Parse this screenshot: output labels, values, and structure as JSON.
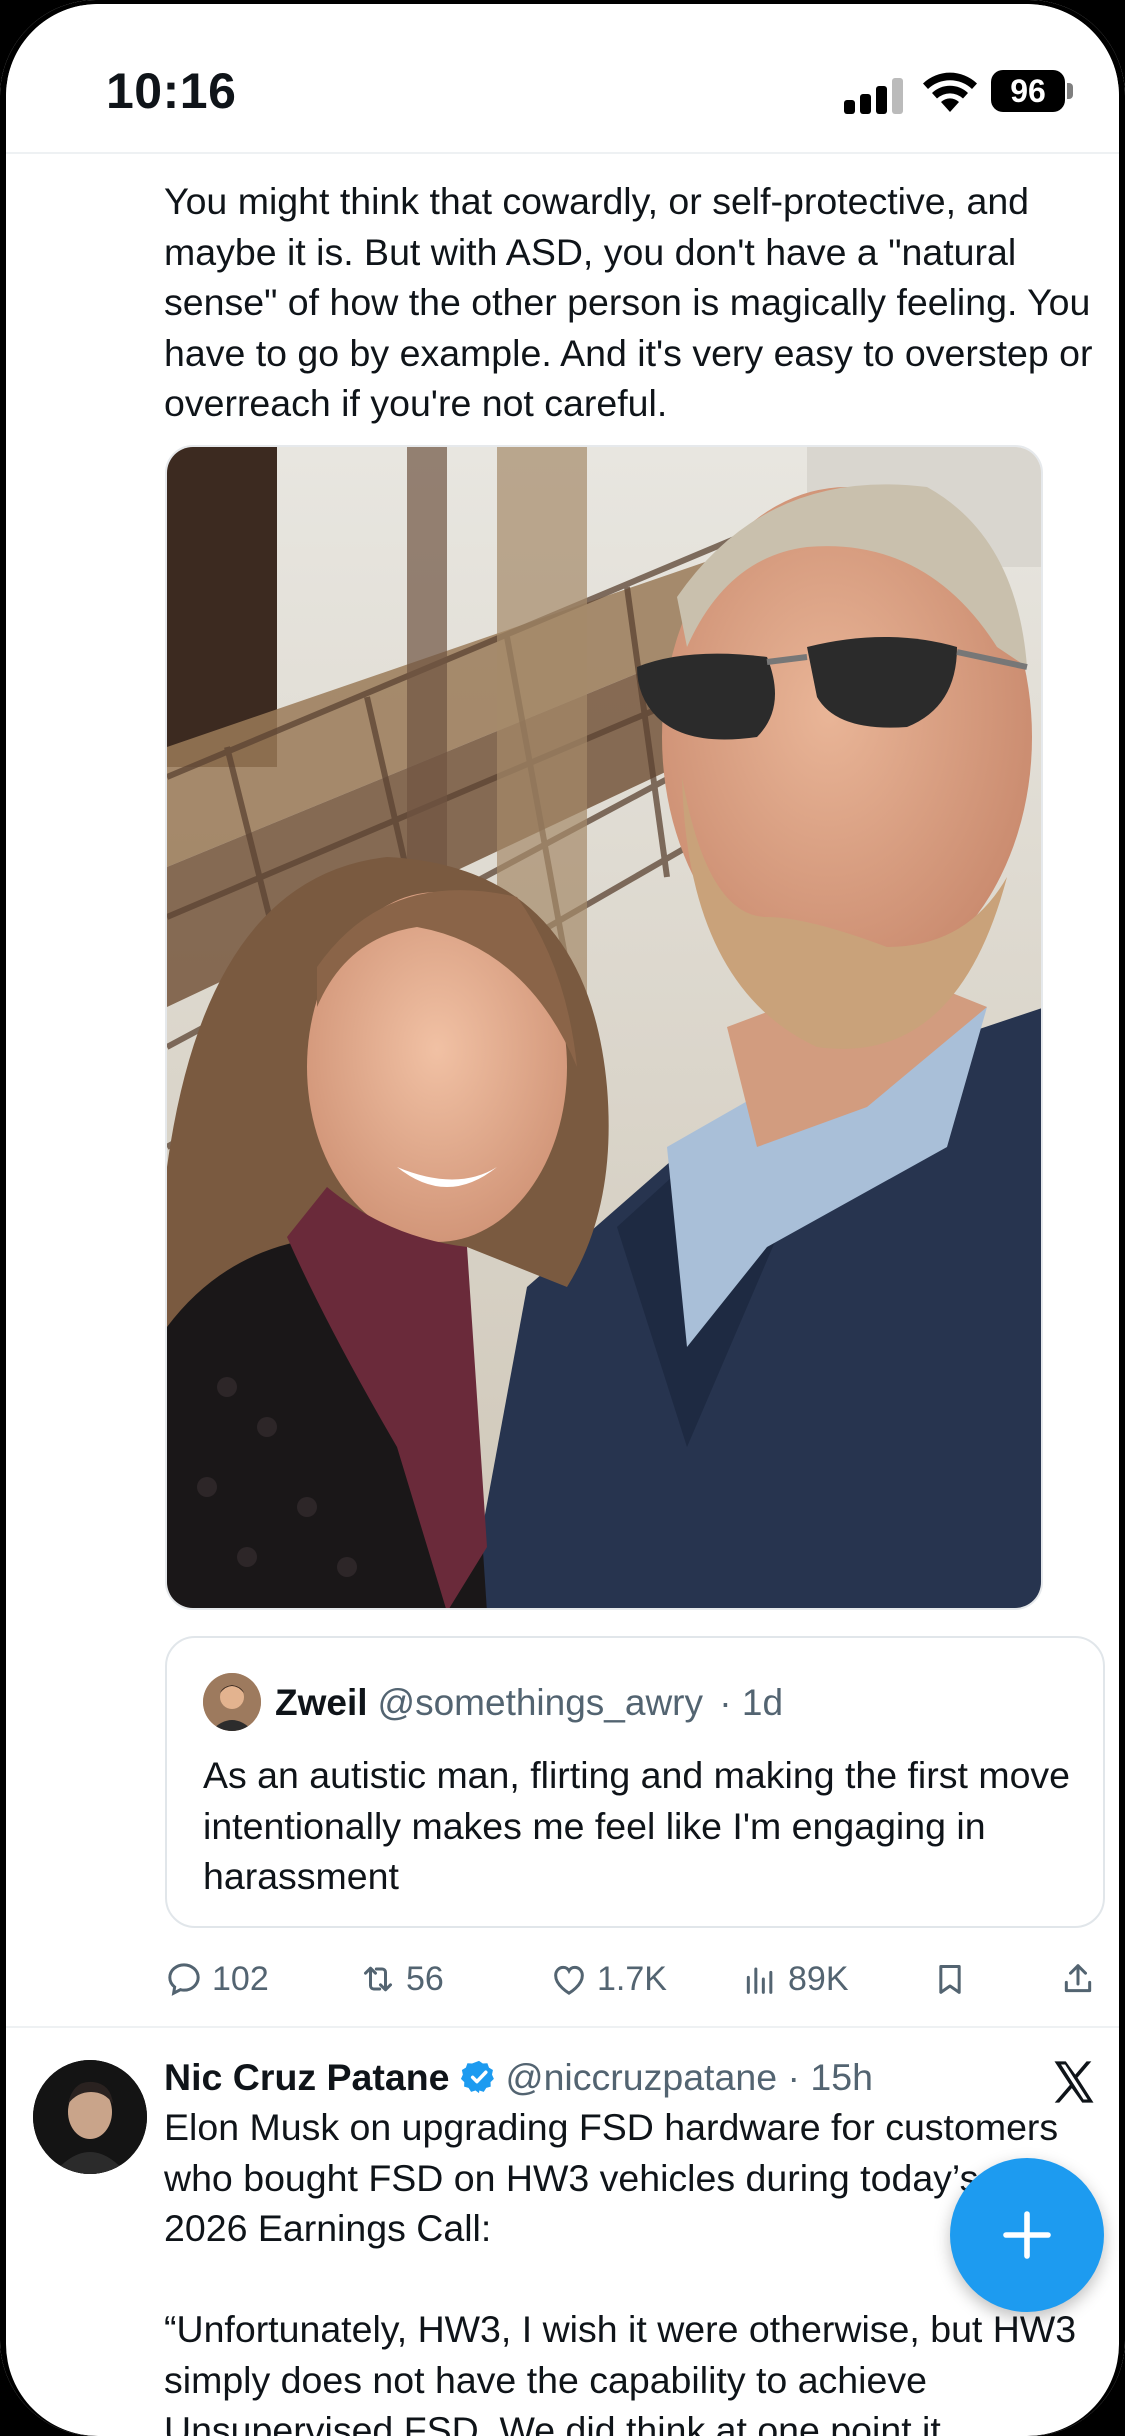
{
  "status_bar": {
    "time": "10:16",
    "battery": "96",
    "icons": [
      "cellular-signal-icon",
      "wifi-icon",
      "battery-icon"
    ]
  },
  "tweet": {
    "text": "You might think that cowardly, or self-protective, and maybe it is.  But with ASD, you don't have a \"natural sense\" of how the other person is magically feeling.  You have to go by example.  And it's very easy to overstep or overreach if you're not careful.",
    "photo": "selfie-photo",
    "quoted": {
      "name": "Zweil",
      "handle": "@somethings_awry",
      "time": "· 1d",
      "text": "As an autistic man, flirting and making the first move intentionally makes me feel like I'm engaging in harassment"
    },
    "actions": {
      "replies": "102",
      "reposts": "56",
      "likes": "1.7K",
      "views": "89K"
    }
  },
  "next_tweet": {
    "name": "Nic Cruz Patane",
    "handle": "@niccruzpatane",
    "time": "· 15h",
    "text": "Elon Musk on upgrading FSD hardware for customers who bought FSD on HW3 vehicles during today’s Q1 2026 Earnings Call:\n\n“Unfortunately, HW3, I wish it were otherwise, but HW3 simply does not have the capability to achieve Unsupervised FSD. We did think at one point it"
  },
  "colors": {
    "accent": "#1d9bf0",
    "text": "#0f1419",
    "secondary": "#536471"
  }
}
